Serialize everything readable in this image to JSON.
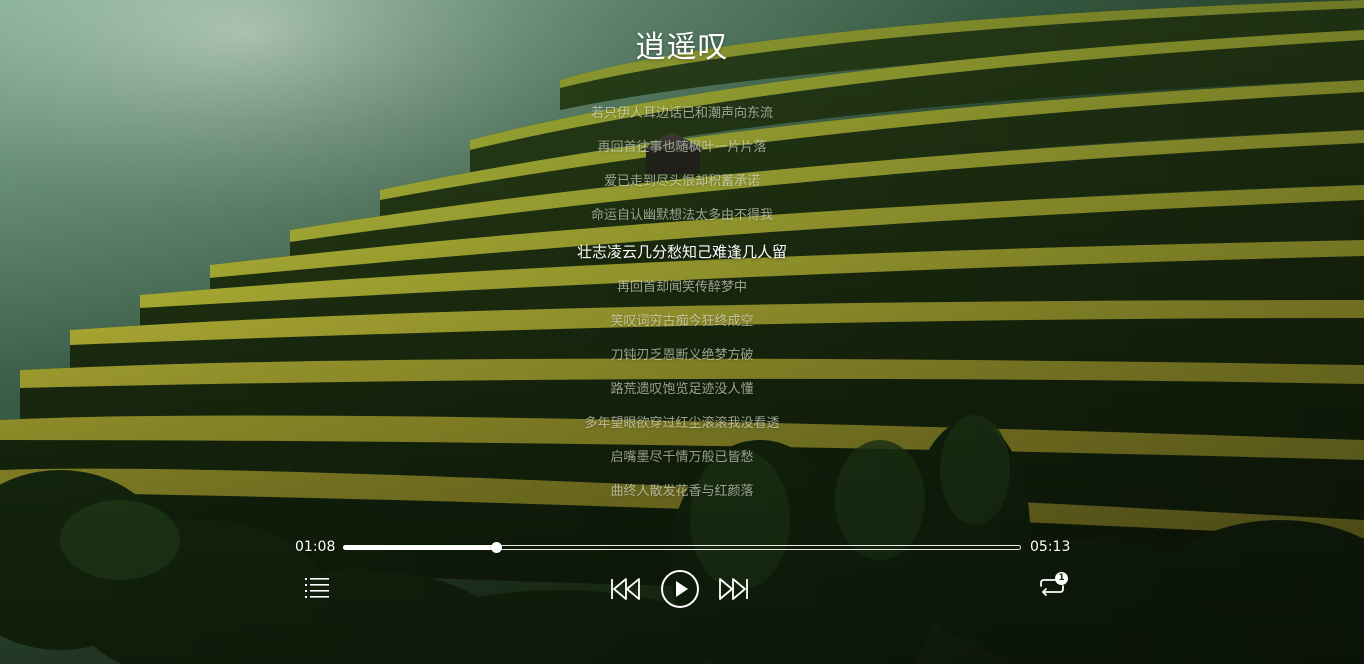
{
  "song": {
    "title": "逍遥叹"
  },
  "lyrics": [
    {
      "text": "若只伊人耳边话已和潮声向东流",
      "active": false
    },
    {
      "text": "再回首往事也随枫叶一片片落",
      "active": false
    },
    {
      "text": "爱已走到尽头恨却积蓄承诺",
      "active": false
    },
    {
      "text": "命运自认幽默想法太多由不得我",
      "active": false
    },
    {
      "text": "壮志凌云几分愁知己难逢几人留",
      "active": true
    },
    {
      "text": "再回首却闻笑传醉梦中",
      "active": false
    },
    {
      "text": "笑叹词穷古痴今狂终成空",
      "active": false
    },
    {
      "text": "刀钝刃乏恩断义绝梦方破",
      "active": false
    },
    {
      "text": "路荒遗叹饱览足迹没人懂",
      "active": false
    },
    {
      "text": "多年望眼欲穿过红尘滚滚我没看透",
      "active": false
    },
    {
      "text": "启嘴墨尽千情万般已皆愁",
      "active": false
    },
    {
      "text": "曲终人散发花香与红颜落",
      "active": false
    }
  ],
  "player": {
    "current_time": "01:08",
    "duration": "05:13",
    "progress": 0.225,
    "loop_badge": "1"
  },
  "icons": {
    "playlist": "playlist-icon",
    "prev": "skip-previous-icon",
    "play": "play-icon",
    "next": "skip-next-icon",
    "loop": "repeat-one-icon"
  },
  "colors": {
    "foreground": "#ffffff"
  }
}
